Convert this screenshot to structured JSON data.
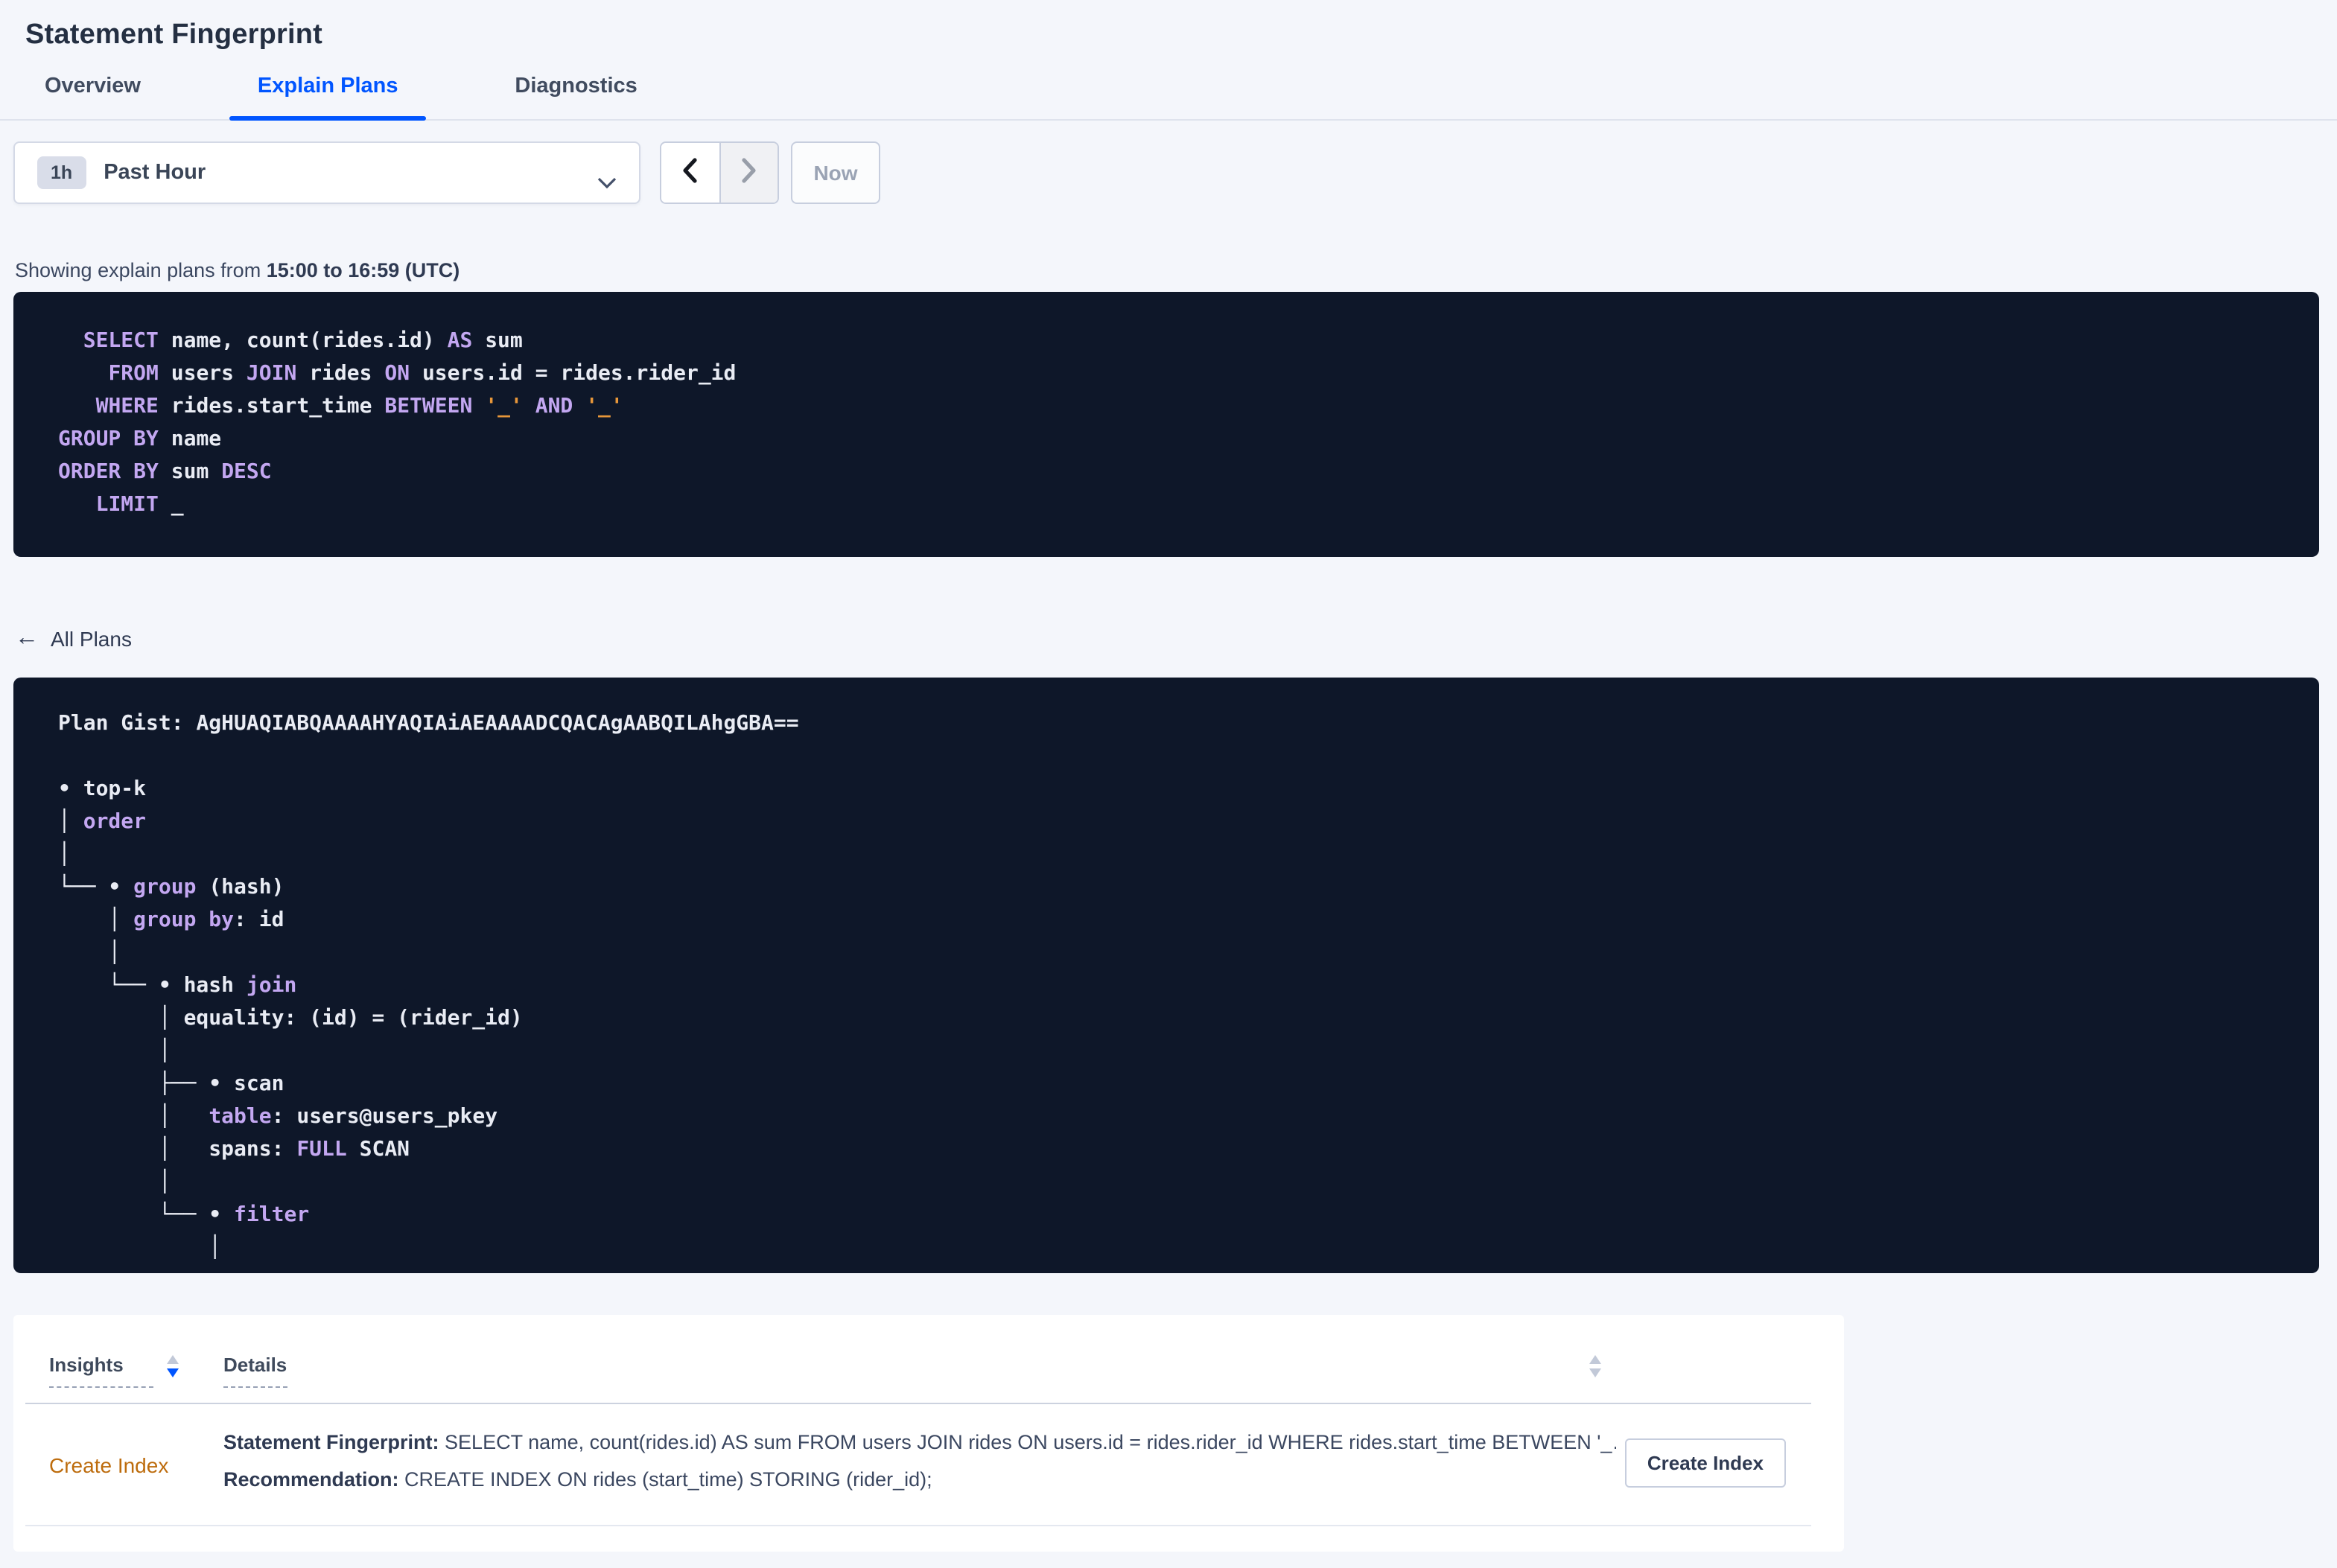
{
  "page": {
    "title": "Statement Fingerprint"
  },
  "tabs": [
    {
      "label": "Overview",
      "active": false
    },
    {
      "label": "Explain Plans",
      "active": true
    },
    {
      "label": "Diagnostics",
      "active": false
    }
  ],
  "time_picker": {
    "badge": "1h",
    "label": "Past Hour"
  },
  "time_nav": {
    "now_label": "Now"
  },
  "showing": {
    "prefix": "Showing explain plans from ",
    "range": "15:00 to 16:59 (UTC)"
  },
  "sql_block": {
    "lines": [
      [
        {
          "c": "p",
          "t": "  "
        },
        {
          "c": "k",
          "t": "SELECT"
        },
        {
          "c": "p",
          "t": " name, count(rides.id) "
        },
        {
          "c": "k",
          "t": "AS"
        },
        {
          "c": "p",
          "t": " sum"
        }
      ],
      [
        {
          "c": "p",
          "t": "    "
        },
        {
          "c": "k",
          "t": "FROM"
        },
        {
          "c": "p",
          "t": " users "
        },
        {
          "c": "k",
          "t": "JOIN"
        },
        {
          "c": "p",
          "t": " rides "
        },
        {
          "c": "k",
          "t": "ON"
        },
        {
          "c": "p",
          "t": " users.id = rides.rider_id"
        }
      ],
      [
        {
          "c": "p",
          "t": "   "
        },
        {
          "c": "k",
          "t": "WHERE"
        },
        {
          "c": "p",
          "t": " rides.start_time "
        },
        {
          "c": "k",
          "t": "BETWEEN"
        },
        {
          "c": "p",
          "t": " "
        },
        {
          "c": "o",
          "t": "'_'"
        },
        {
          "c": "p",
          "t": " "
        },
        {
          "c": "k",
          "t": "AND"
        },
        {
          "c": "p",
          "t": " "
        },
        {
          "c": "o",
          "t": "'_'"
        }
      ],
      [
        {
          "c": "k",
          "t": "GROUP BY"
        },
        {
          "c": "p",
          "t": " name"
        }
      ],
      [
        {
          "c": "k",
          "t": "ORDER BY"
        },
        {
          "c": "p",
          "t": " sum "
        },
        {
          "c": "k",
          "t": "DESC"
        }
      ],
      [
        {
          "c": "p",
          "t": "   "
        },
        {
          "c": "k",
          "t": "LIMIT"
        },
        {
          "c": "p",
          "t": " _"
        }
      ]
    ]
  },
  "back_link": {
    "label": "All Plans"
  },
  "plan_block": {
    "gist_label": "Plan Gist: ",
    "gist": "AgHUAQIABQAAAAHYAQIAiAEAAAADCQACAgAABQILAhgGBA==",
    "lines": [
      [
        {
          "c": "p",
          "t": "• top-k"
        }
      ],
      [
        {
          "c": "p",
          "t": "│ "
        },
        {
          "c": "k",
          "t": "order"
        }
      ],
      [
        {
          "c": "p",
          "t": "│"
        }
      ],
      [
        {
          "c": "p",
          "t": "└── • "
        },
        {
          "c": "k",
          "t": "group"
        },
        {
          "c": "p",
          "t": " (hash)"
        }
      ],
      [
        {
          "c": "p",
          "t": "    │ "
        },
        {
          "c": "k",
          "t": "group by"
        },
        {
          "c": "p",
          "t": ": id"
        }
      ],
      [
        {
          "c": "p",
          "t": "    │"
        }
      ],
      [
        {
          "c": "p",
          "t": "    └── • hash "
        },
        {
          "c": "k",
          "t": "join"
        }
      ],
      [
        {
          "c": "p",
          "t": "        │ equality: (id) = (rider_id)"
        }
      ],
      [
        {
          "c": "p",
          "t": "        │"
        }
      ],
      [
        {
          "c": "p",
          "t": "        ├── • scan"
        }
      ],
      [
        {
          "c": "p",
          "t": "        │   "
        },
        {
          "c": "k",
          "t": "table"
        },
        {
          "c": "p",
          "t": ": users@users_pkey"
        }
      ],
      [
        {
          "c": "p",
          "t": "        │   spans: "
        },
        {
          "c": "k",
          "t": "FULL"
        },
        {
          "c": "p",
          "t": " SCAN"
        }
      ],
      [
        {
          "c": "p",
          "t": "        │"
        }
      ],
      [
        {
          "c": "p",
          "t": "        └── • "
        },
        {
          "c": "k",
          "t": "filter"
        }
      ],
      [
        {
          "c": "p",
          "t": "            │"
        }
      ]
    ]
  },
  "insights_table": {
    "columns": [
      "Insights",
      "Details"
    ],
    "rows": [
      {
        "insight": "Create Index",
        "details": [
          {
            "label": "Statement Fingerprint:",
            "text": " SELECT name, count(rides.id) AS sum FROM users JOIN rides ON users.id = rides.rider_id WHERE rides.start_time BETWEEN '_…"
          },
          {
            "label": "Recommendation:",
            "text": " CREATE INDEX ON rides (start_time) STORING (rider_id);"
          }
        ],
        "action_label": "Create Index"
      }
    ]
  },
  "colors": {
    "accent_blue": "#0055ff",
    "insight_orange": "#bd6c0d",
    "code_background": "#0e1729",
    "keyword_purple": "#c3a7f1",
    "placeholder_orange": "#e8973a"
  }
}
